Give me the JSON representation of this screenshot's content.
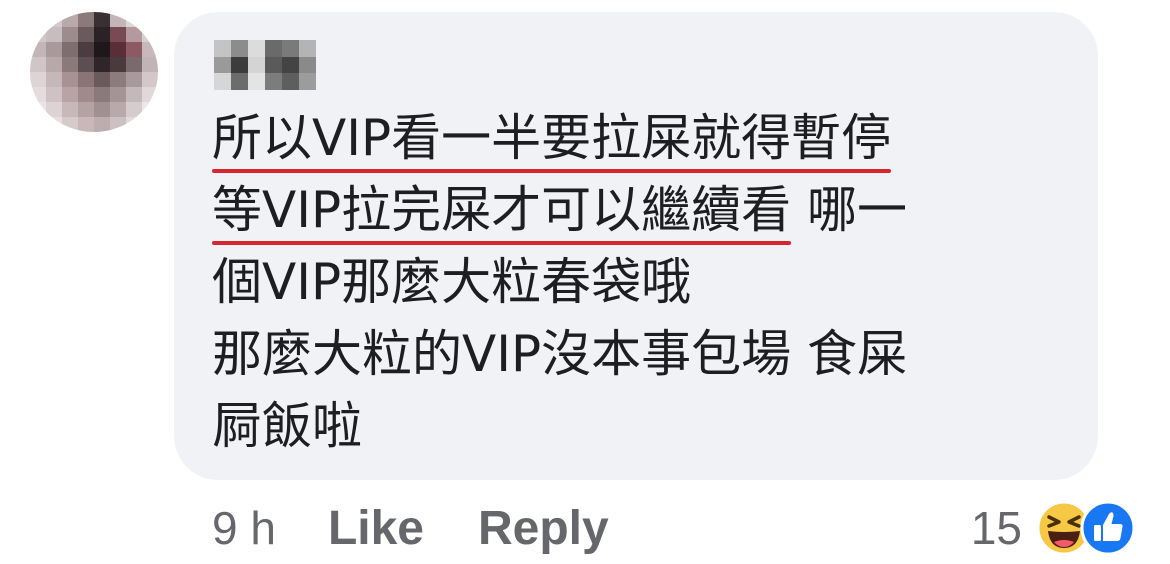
{
  "comment": {
    "lines": [
      [
        "所以VIP看一半要拉屎就得暫停"
      ],
      [
        "等VIP拉完屎才可以繼續看",
        " 哪一"
      ],
      [
        "個VIP那麼大粒春袋哦"
      ],
      [
        "那麼大粒的VIP沒本事包場 食屎"
      ],
      [
        "屙飯啦"
      ]
    ]
  },
  "footer": {
    "time": "9 h",
    "like_label": "Like",
    "reply_label": "Reply",
    "reaction_count": "15"
  },
  "reactions": [
    "haha-icon",
    "like-icon"
  ],
  "colors": {
    "bubble": "#f0f2f5",
    "underline": "#d9262e",
    "meta_text": "#65676b",
    "like_blue": "#1877f2",
    "haha_yellow": "#f7c844"
  }
}
